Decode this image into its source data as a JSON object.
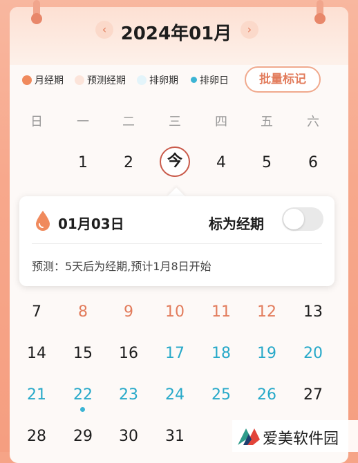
{
  "calendar": {
    "month_title": "2024年01月",
    "prev_icon": "chevron-left-icon",
    "next_icon": "chevron-right-icon"
  },
  "legend": [
    {
      "label": "月经期",
      "color": "#f08a5d"
    },
    {
      "label": "预测经期",
      "color": "#fce4da"
    },
    {
      "label": "排卵期",
      "color": "#e3f4fa"
    },
    {
      "label": "排卵日",
      "color": "#3cb4d4"
    }
  ],
  "batch_button": "批量标记",
  "weekdays": [
    "日",
    "一",
    "二",
    "三",
    "四",
    "五",
    "六"
  ],
  "week1": [
    "1",
    "2",
    "今",
    "4",
    "5",
    "6"
  ],
  "week2": [
    "7",
    "8",
    "9",
    "10",
    "11",
    "12",
    "13"
  ],
  "week3": [
    "14",
    "15",
    "16",
    "17",
    "18",
    "19",
    "20"
  ],
  "week4": [
    "21",
    "22",
    "23",
    "24",
    "25",
    "26",
    "27"
  ],
  "week5": [
    "28",
    "29",
    "30",
    "31"
  ],
  "popup": {
    "date": "01月03日",
    "mark_label": "标为经期",
    "toggle_on": false,
    "prediction": "预测：5天后为经期,预计1月8日开始"
  },
  "watermark": "爱美软件园"
}
